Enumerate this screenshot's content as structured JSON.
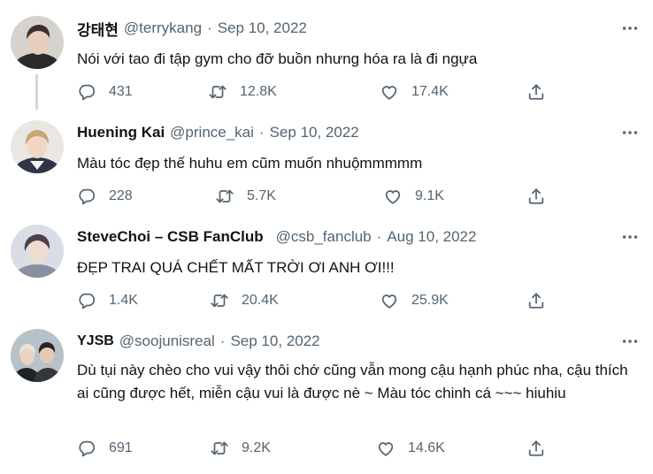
{
  "tweets": [
    {
      "name": "강태현",
      "handle": "@terrykang",
      "separator": "·",
      "date": "Sep 10, 2022",
      "text": "Nói với tao đi tập gym cho đỡ buồn nhưng hóa ra là đi ngựa",
      "replies": "431",
      "retweets": "12.8K",
      "likes": "17.4K"
    },
    {
      "name": "Huening Kai",
      "handle": "@prince_kai",
      "separator": "·",
      "date": "Sep 10, 2022",
      "text": "Màu tóc đẹp thế huhu em cũm muốn nhuộmmmmm",
      "replies": "228",
      "retweets": "5.7K",
      "likes": "9.1K"
    },
    {
      "name": "SteveChoi – CSB FanClub",
      "handle": "@csb_fanclub",
      "separator": "·",
      "date": "Aug 10, 2022",
      "text": "ĐẸP TRAI QUÁ CHẾT MẤT TRỜI ƠI ANH ƠI!!!",
      "replies": "1.4K",
      "retweets": "20.4K",
      "likes": "25.9K"
    },
    {
      "name": "YJSB",
      "handle": "@soojunisreal",
      "separator": "·",
      "date": "Sep 10, 2022",
      "text": "Dù tụi này chèo cho vui vậy thôi chớ cũng vẫn mong cậu hạnh phúc nha, cậu thích ai cũng được hết, miễn cậu vui là được nè ~ Màu tóc chinh cá ~~~ hiuhiu",
      "replies": "691",
      "retweets": "9.2K",
      "likes": "14.6K"
    }
  ],
  "icons": {
    "reply": "reply-icon",
    "retweet": "retweet-icon",
    "like": "heart-icon",
    "share": "share-icon",
    "more": "more-options-icon"
  },
  "colors": {
    "text": "#0f1419",
    "secondary": "#536471",
    "thread_line": "#cfd9de"
  }
}
